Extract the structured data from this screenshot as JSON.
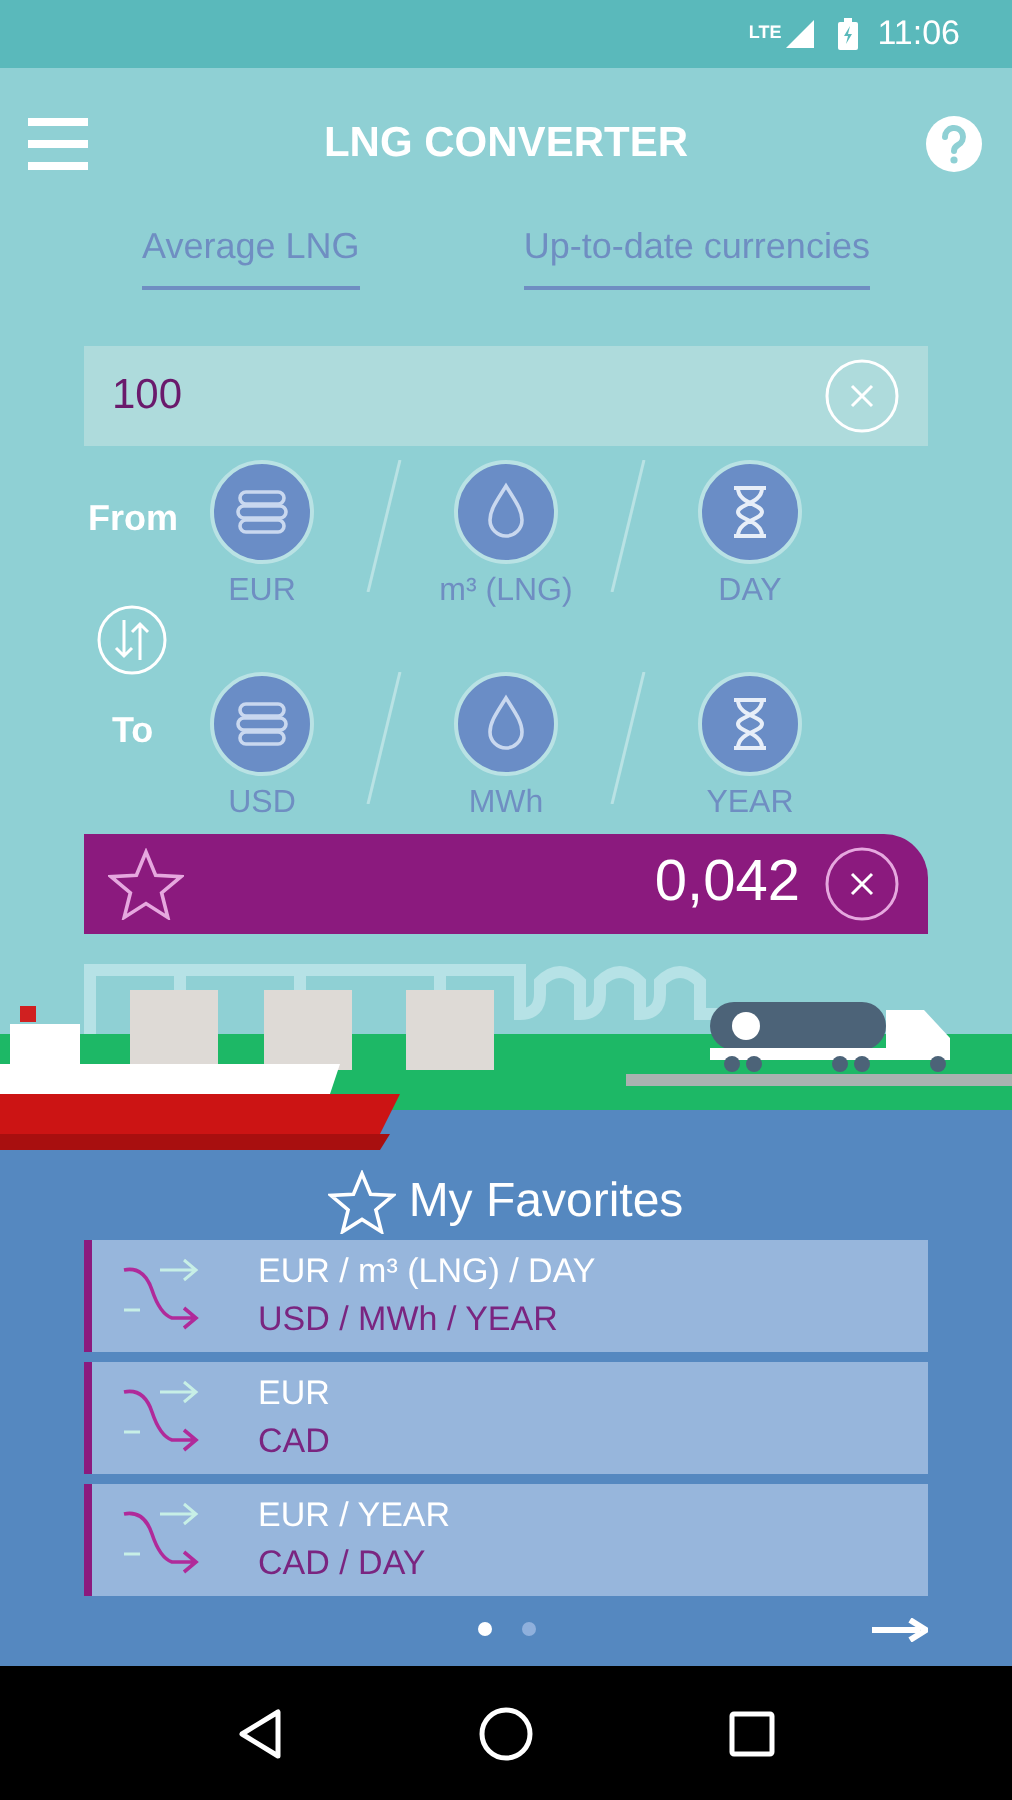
{
  "status_bar": {
    "network": "LTE",
    "time": "11:06"
  },
  "header": {
    "title": "LNG CONVERTER"
  },
  "tabs": [
    {
      "label": "Average LNG",
      "selected": false
    },
    {
      "label": "Up-to-date currencies",
      "selected": false
    }
  ],
  "amount": {
    "value": "100"
  },
  "from": {
    "label": "From",
    "units": [
      {
        "kind": "money",
        "label": "EUR"
      },
      {
        "kind": "drop",
        "label": "m³ (LNG)"
      },
      {
        "kind": "time",
        "label": "DAY"
      }
    ]
  },
  "to": {
    "label": "To",
    "units": [
      {
        "kind": "money",
        "label": "USD"
      },
      {
        "kind": "drop",
        "label": "MWh"
      },
      {
        "kind": "time",
        "label": "YEAR"
      }
    ]
  },
  "result": {
    "value": "0,042",
    "favorite": false
  },
  "favorites": {
    "title": "My Favorites",
    "items": [
      {
        "from": "EUR / m³ (LNG) / DAY",
        "to": "USD / MWh / YEAR"
      },
      {
        "from": "EUR",
        "to": "CAD"
      },
      {
        "from": "EUR / YEAR",
        "to": "CAD / DAY"
      }
    ],
    "pages": [
      {
        "selected": true
      },
      {
        "selected": false
      }
    ]
  }
}
